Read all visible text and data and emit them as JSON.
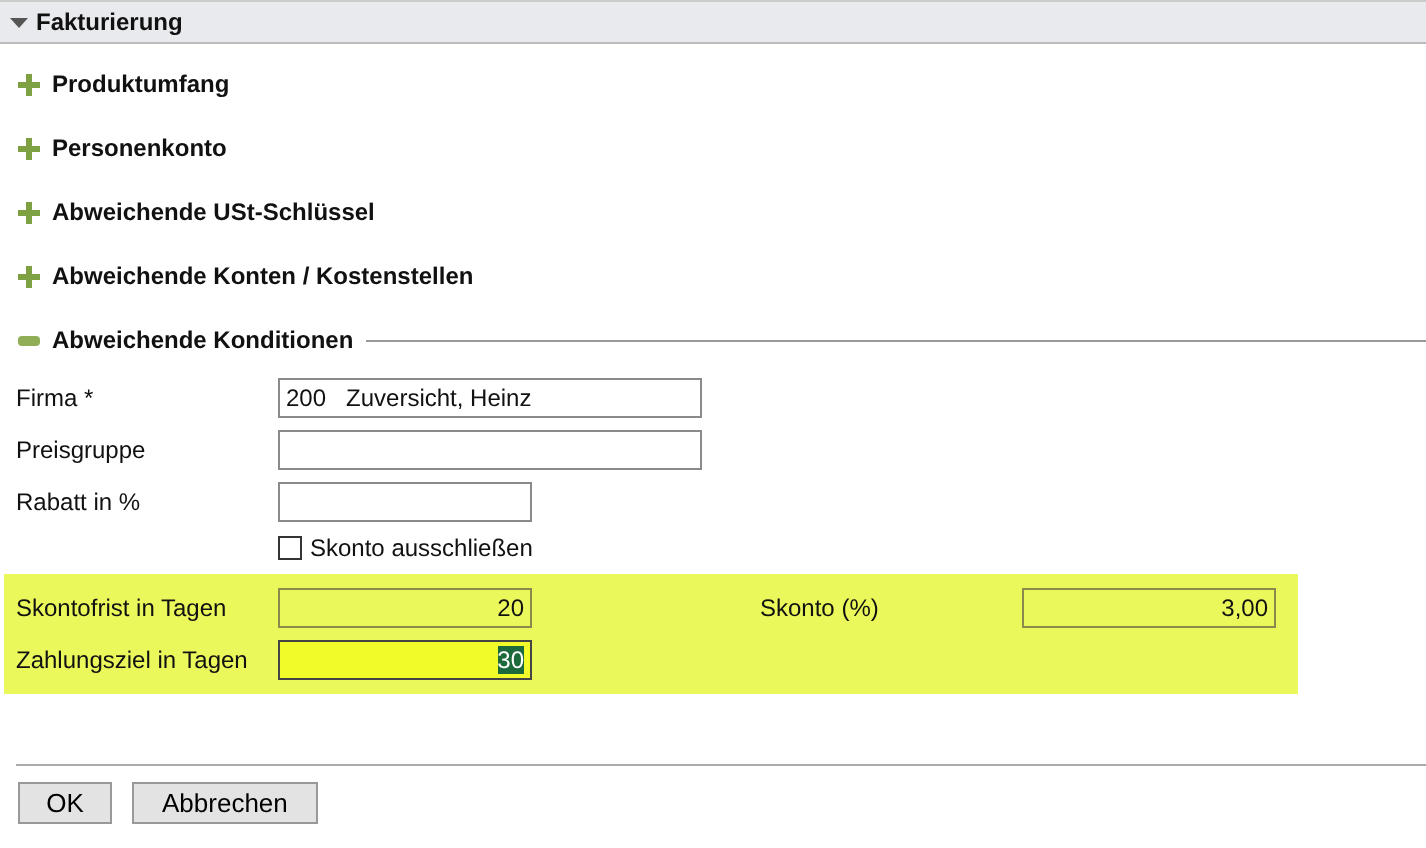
{
  "panel": {
    "title": "Fakturierung",
    "expanded": true
  },
  "sections": [
    {
      "label": "Produktumfang",
      "expanded": false
    },
    {
      "label": "Personenkonto",
      "expanded": false
    },
    {
      "label": "Abweichende USt-Schlüssel",
      "expanded": false
    },
    {
      "label": "Abweichende Konten / Kostenstellen",
      "expanded": false
    },
    {
      "label": "Abweichende Konditionen",
      "expanded": true
    }
  ],
  "fields": [
    {
      "label": "Firma *",
      "value": "200   Zuversicht, Heinz",
      "kind": "wide"
    },
    {
      "label": "Preisgruppe",
      "kind": "wide"
    },
    {
      "label": "Rabatt in %",
      "kind": "narrow"
    }
  ],
  "checkbox": {
    "label": "Skonto ausschließen",
    "checked": false
  },
  "highlighted_fields": [
    {
      "label": "Skontofrist in Tagen",
      "value": "20",
      "focused": false
    },
    {
      "label": "Zahlungsziel in Tagen",
      "value": "30",
      "focused": true
    }
  ],
  "side_field": {
    "label": "Skonto (%)",
    "value": "3,00"
  },
  "buttons": [
    "OK",
    "Abbrechen"
  ]
}
